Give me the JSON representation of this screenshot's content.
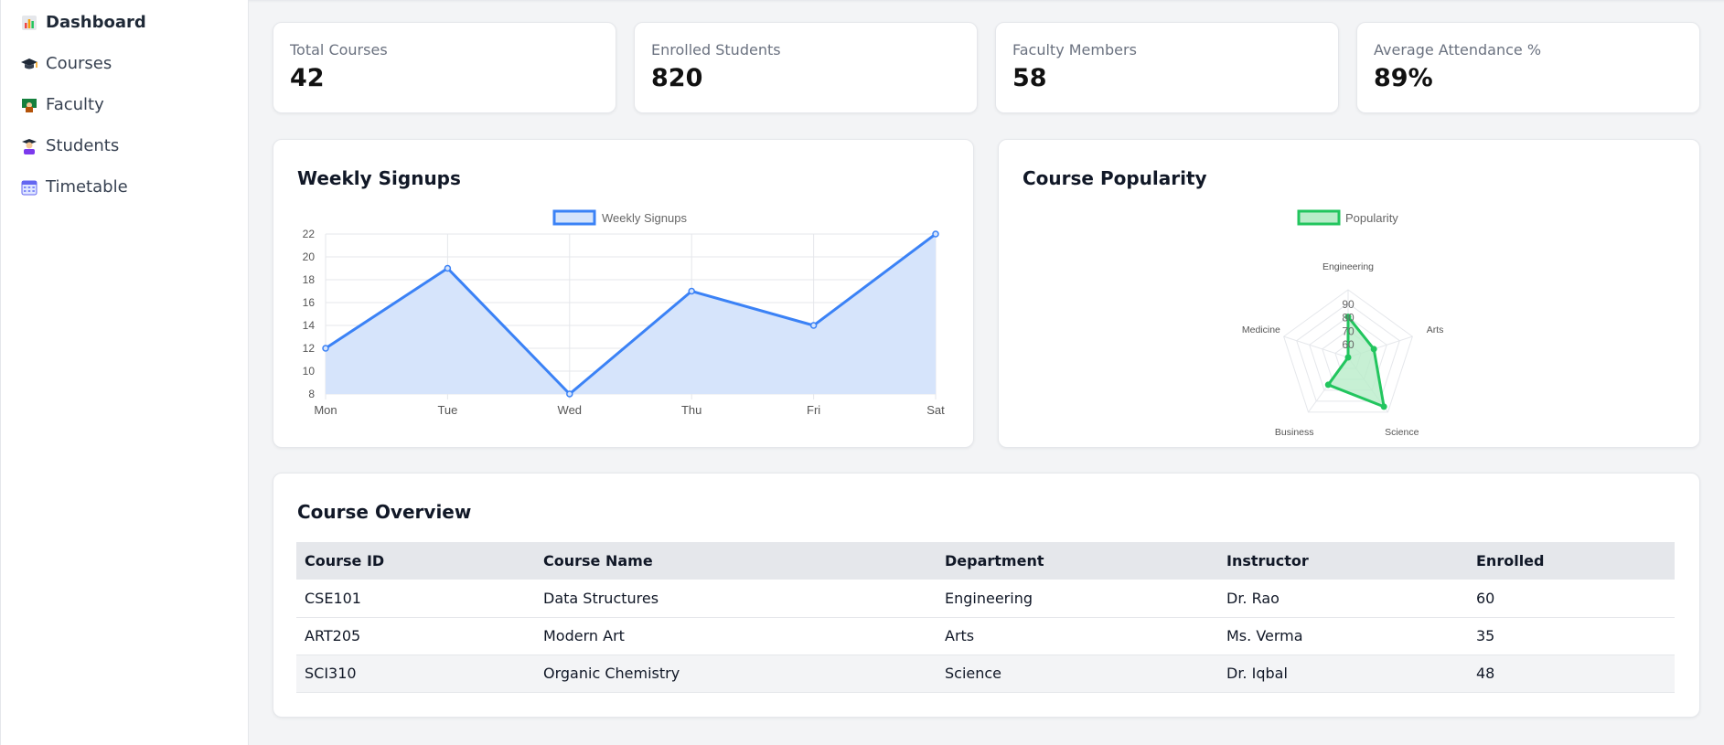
{
  "sidebar": {
    "items": [
      {
        "label": "Dashboard",
        "icon": "bar-chart-icon",
        "active": true
      },
      {
        "label": "Courses",
        "icon": "graduation-cap-icon",
        "active": false
      },
      {
        "label": "Faculty",
        "icon": "teacher-icon",
        "active": false
      },
      {
        "label": "Students",
        "icon": "student-icon",
        "active": false
      },
      {
        "label": "Timetable",
        "icon": "calendar-icon",
        "active": false
      }
    ]
  },
  "stats": [
    {
      "label": "Total Courses",
      "value": "42"
    },
    {
      "label": "Enrolled Students",
      "value": "820"
    },
    {
      "label": "Faculty Members",
      "value": "58"
    },
    {
      "label": "Average Attendance %",
      "value": "89%"
    }
  ],
  "signups": {
    "title": "Weekly Signups"
  },
  "popularity": {
    "title": "Course Popularity"
  },
  "overview": {
    "title": "Course Overview",
    "columns": [
      "Course ID",
      "Course Name",
      "Department",
      "Instructor",
      "Enrolled"
    ],
    "rows": [
      [
        "CSE101",
        "Data Structures",
        "Engineering",
        "Dr. Rao",
        "60"
      ],
      [
        "ART205",
        "Modern Art",
        "Arts",
        "Ms. Verma",
        "35"
      ],
      [
        "SCI310",
        "Organic Chemistry",
        "Science",
        "Dr. Iqbal",
        "48"
      ]
    ]
  },
  "chart_data": [
    {
      "type": "area",
      "title": "Weekly Signups",
      "categories": [
        "Mon",
        "Tue",
        "Wed",
        "Thu",
        "Fri",
        "Sat"
      ],
      "series": [
        {
          "name": "Weekly Signups",
          "values": [
            12,
            19,
            8,
            17,
            14,
            22
          ]
        }
      ],
      "ylim": [
        8,
        22
      ],
      "yticks": [
        8,
        10,
        12,
        14,
        16,
        18,
        20,
        22
      ],
      "grid": true,
      "legend": "top",
      "color": "#3b82f6",
      "fill": "#d6e4fb"
    },
    {
      "type": "radar",
      "title": "Course Popularity",
      "categories": [
        "Engineering",
        "Arts",
        "Science",
        "Business",
        "Medicine"
      ],
      "series": [
        {
          "name": "Popularity",
          "values": [
            80,
            70,
            95,
            75,
            50
          ]
        }
      ],
      "rlim": [
        50,
        100
      ],
      "rticks": [
        60,
        70,
        80,
        90
      ],
      "legend": "top",
      "color": "#22c55e",
      "fill": "#b9ecc9"
    }
  ]
}
